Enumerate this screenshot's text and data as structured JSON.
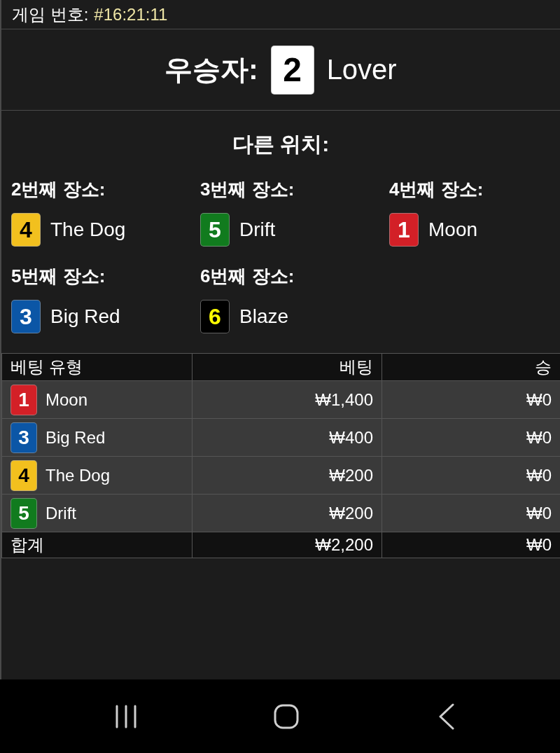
{
  "header": {
    "label": "게임 번호:",
    "value": "#16:21:11"
  },
  "winner": {
    "label": "우승자:",
    "runner": {
      "number": "2",
      "name": "Lover",
      "color": "#ffffff"
    }
  },
  "other_positions": {
    "title": "다른 위치:",
    "places": [
      {
        "label": "2번째 장소:",
        "runner": {
          "number": "4",
          "name": "The Dog",
          "color": "#f2c01e"
        }
      },
      {
        "label": "3번째 장소:",
        "runner": {
          "number": "5",
          "name": "Drift",
          "color": "#117b1e"
        }
      },
      {
        "label": "4번째 장소:",
        "runner": {
          "number": "1",
          "name": "Moon",
          "color": "#d32027"
        }
      },
      {
        "label": "5번째 장소:",
        "runner": {
          "number": "3",
          "name": "Big Red",
          "color": "#0b56a6"
        }
      },
      {
        "label": "6번째 장소:",
        "runner": {
          "number": "6",
          "name": "Blaze",
          "color": "#000000"
        }
      }
    ]
  },
  "bets_table": {
    "columns": [
      "베팅 유형",
      "베팅",
      "승"
    ],
    "rows": [
      {
        "runner": {
          "number": "1",
          "name": "Moon",
          "color": "#d32027"
        },
        "bet": "₩1,400",
        "win": "₩0"
      },
      {
        "runner": {
          "number": "3",
          "name": "Big Red",
          "color": "#0b56a6"
        },
        "bet": "₩400",
        "win": "₩0"
      },
      {
        "runner": {
          "number": "4",
          "name": "The Dog",
          "color": "#f2c01e"
        },
        "bet": "₩200",
        "win": "₩0"
      },
      {
        "runner": {
          "number": "5",
          "name": "Drift",
          "color": "#117b1e"
        },
        "bet": "₩200",
        "win": "₩0"
      }
    ],
    "total": {
      "label": "합계",
      "bet": "₩2,200",
      "win": "₩0"
    }
  },
  "nav_bar": {
    "buttons": [
      {
        "kind": "recents"
      },
      {
        "kind": "home"
      },
      {
        "kind": "back"
      }
    ]
  }
}
